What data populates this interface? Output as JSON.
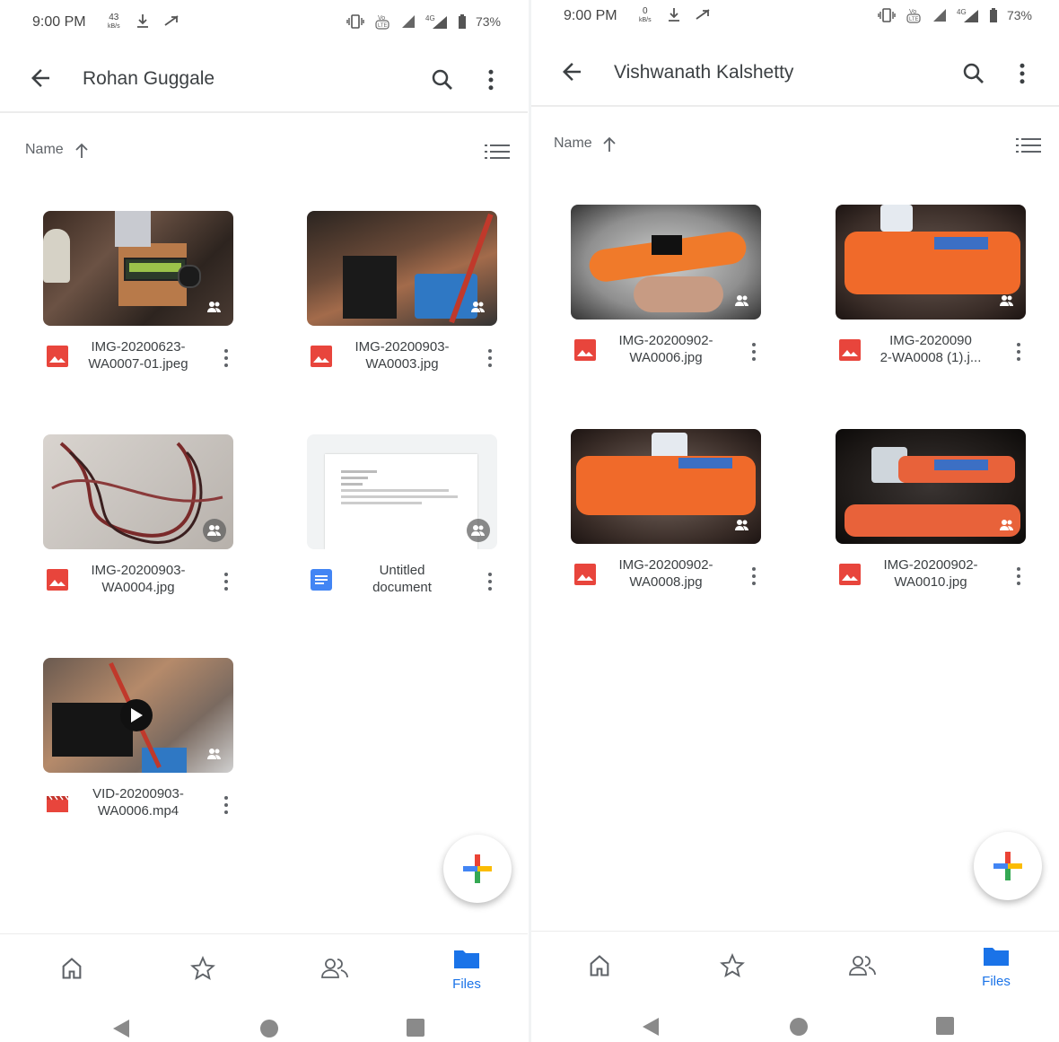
{
  "colors": {
    "accent": "#1a73e8",
    "image_icon": "#e8453c",
    "video_icon": "#e8453c",
    "doc_icon": "#4285f4",
    "text_primary": "#3c4043",
    "text_secondary": "#5f6368"
  },
  "left": {
    "status": {
      "time": "9:00 PM",
      "net_speed": "43",
      "net_unit": "kB/s",
      "battery": "73%"
    },
    "appbar": {
      "title": "Rohan Guggale"
    },
    "sort": {
      "label": "Name"
    },
    "files": [
      {
        "name": "IMG-20200623-WA0007-01.jpeg",
        "line1": "IMG-20200623-",
        "line2": "WA0007-01.jpeg",
        "type": "image",
        "thumb": "circuit-lcd",
        "shared": true
      },
      {
        "name": "IMG-20200903-WA0003.jpg",
        "line1": "IMG-20200903-",
        "line2": "WA0003.jpg",
        "type": "image",
        "thumb": "circuit-board",
        "shared": true
      },
      {
        "name": "IMG-20200903-WA0004.jpg",
        "line1": "IMG-20200903-",
        "line2": "WA0004.jpg",
        "type": "image",
        "thumb": "twisted-wire",
        "shared": true
      },
      {
        "name": "Untitled document",
        "line1": "Untitled",
        "line2": "document",
        "type": "document",
        "thumb": "doc-page",
        "shared": true
      },
      {
        "name": "VID-20200903-WA0006.mp4",
        "line1": "VID-20200903-",
        "line2": "WA0006.mp4",
        "type": "video",
        "thumb": "circuit-video",
        "shared": true
      }
    ],
    "nav": {
      "files_label": "Files"
    }
  },
  "right": {
    "status": {
      "time": "9:00 PM",
      "net_speed": "0",
      "net_unit": "kB/s",
      "battery": "73%"
    },
    "appbar": {
      "title": "Vishwanath Kalshetty"
    },
    "sort": {
      "label": "Name"
    },
    "files": [
      {
        "name": "IMG-20200902-WA0006.jpg",
        "line1": "IMG-20200902-",
        "line2": "WA0006.jpg",
        "type": "image",
        "thumb": "torch-closed",
        "shared": true
      },
      {
        "name": "IMG-20200902-WA0008 (1).j...",
        "line1": "IMG-2020090",
        "line2": "2-WA0008 (1).j...",
        "type": "image",
        "thumb": "torch-open",
        "shared": true
      },
      {
        "name": "IMG-20200902-WA0008.jpg",
        "line1": "IMG-20200902-",
        "line2": "WA0008.jpg",
        "type": "image",
        "thumb": "torch-open",
        "shared": true
      },
      {
        "name": "IMG-20200902-WA0010.jpg",
        "line1": "IMG-20200902-",
        "line2": "WA0010.jpg",
        "type": "image",
        "thumb": "torch-dark",
        "shared": true
      }
    ],
    "nav": {
      "files_label": "Files"
    }
  }
}
